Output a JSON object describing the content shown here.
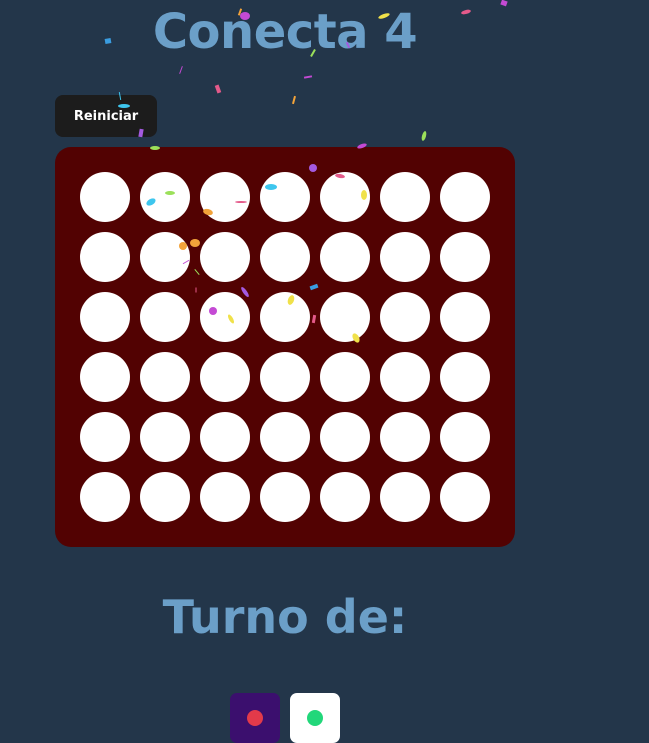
{
  "title": "Conecta 4",
  "reset_label": "Reiniciar",
  "turn_label": "Turno de:",
  "board": {
    "rows": 6,
    "columns": 7,
    "cells": [
      [
        "empty",
        "empty",
        "empty",
        "empty",
        "empty",
        "empty",
        "empty"
      ],
      [
        "empty",
        "empty",
        "empty",
        "empty",
        "empty",
        "empty",
        "empty"
      ],
      [
        "empty",
        "empty",
        "empty",
        "empty",
        "empty",
        "empty",
        "empty"
      ],
      [
        "empty",
        "empty",
        "empty",
        "empty",
        "empty",
        "empty",
        "empty"
      ],
      [
        "empty",
        "empty",
        "empty",
        "empty",
        "empty",
        "empty",
        "empty"
      ],
      [
        "empty",
        "empty",
        "empty",
        "empty",
        "empty",
        "empty",
        "empty"
      ]
    ]
  },
  "players": [
    {
      "box_color": "#3b0f6e",
      "piece_color": "#e23a4a",
      "active": true
    },
    {
      "box_color": "#ffffff",
      "piece_color": "#22d77a",
      "active": false
    }
  ],
  "colors": {
    "background": "#23364a",
    "title": "#6b9fc8",
    "board": "#520202",
    "cell_empty": "#ffffff",
    "button_bg": "#1c1c1c",
    "button_text": "#ffffff"
  },
  "confetti_colors": [
    "#f0e14a",
    "#c44ad4",
    "#e45a8a",
    "#3ec6ee",
    "#9be05a",
    "#f2a33a",
    "#a45ae0",
    "#3a9de0"
  ]
}
